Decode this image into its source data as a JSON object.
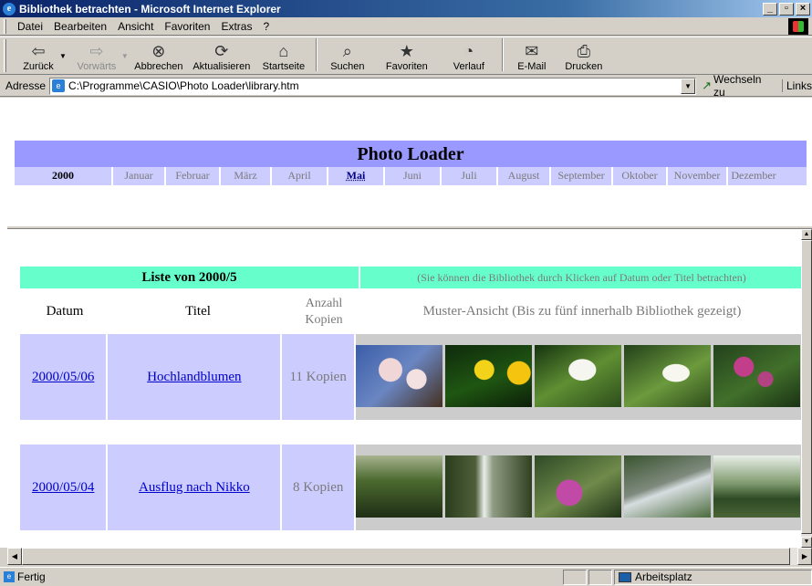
{
  "window": {
    "title": "Bibliothek betrachten - Microsoft Internet Explorer"
  },
  "menu": {
    "items": [
      "Datei",
      "Bearbeiten",
      "Ansicht",
      "Favoriten",
      "Extras",
      "?"
    ]
  },
  "toolbar": {
    "back": "Zurück",
    "forward": "Vorwärts",
    "stop": "Abbrechen",
    "refresh": "Aktualisieren",
    "home": "Startseite",
    "search": "Suchen",
    "favorites": "Favoriten",
    "history": "Verlauf",
    "mail": "E-Mail",
    "print": "Drucken"
  },
  "address": {
    "label": "Adresse",
    "value": "C:\\Programme\\CASIO\\Photo Loader\\library.htm",
    "go": "Wechseln zu",
    "links": "Links"
  },
  "page": {
    "brand": "Photo Loader",
    "year": "2000",
    "months": [
      "Januar",
      "Februar",
      "März",
      "April",
      "Mai",
      "Juni",
      "Juli",
      "August",
      "September",
      "Oktober",
      "November",
      "Dezember"
    ],
    "active_month": "Mai"
  },
  "library": {
    "heading": "Liste von 2000/5",
    "hint": "(Sie können die Bibliothek durch Klicken auf Datum oder Titel betrachten)",
    "columns": {
      "date": "Datum",
      "title": "Titel",
      "count": "Anzahl Kopien",
      "preview": "Muster-Ansicht (Bis zu fünf innerhalb Bibliothek gezeigt)"
    },
    "rows": [
      {
        "date": "2000/05/06",
        "title": "Hochlandblumen",
        "count": "11 Kopien"
      },
      {
        "date": "2000/05/04",
        "title": "Ausflug nach Nikko",
        "count": "8 Kopien"
      }
    ]
  },
  "status": {
    "message": "Fertig",
    "zone": "Arbeitsplatz"
  }
}
